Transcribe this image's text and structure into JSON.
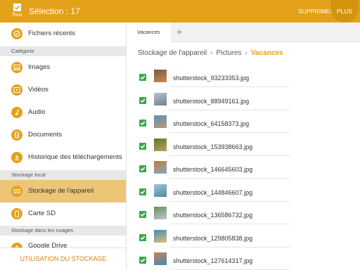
{
  "topbar": {
    "select_all_label": "Tous",
    "selection_title": "Sélection : 17",
    "delete_label": "SUPPRIMER",
    "more_label": "PLUS",
    "accent": "#e3a11a"
  },
  "sidebar": {
    "recent": "Fichiers récents",
    "category_header": "Catégorie",
    "categories": [
      "Images",
      "Vidéos",
      "Audio",
      "Documents",
      "Historique des téléchargements"
    ],
    "local_header": "Stockage local",
    "device": "Stockage de l'appareil",
    "sdcard": "Carte SD",
    "cloud_header": "Stockage dans les nuages",
    "gdrive": "Google Drive",
    "usage_button": "UTILISATION DU STOCKAGE"
  },
  "tabs": {
    "active": "Vacances",
    "add": "+"
  },
  "breadcrumb": [
    "Stockage de l'appareil",
    "Pictures",
    "Vacances"
  ],
  "files": [
    {
      "name": "shutterstock_93233353.jpg",
      "checked": true,
      "thumb": [
        "#7a5b3a",
        "#c98a5a"
      ]
    },
    {
      "name": "shutterstock_88949161.jpg",
      "checked": true,
      "thumb": [
        "#b7c6d1",
        "#6c7f8e"
      ]
    },
    {
      "name": "shutterstock_64158373.jpg",
      "checked": true,
      "thumb": [
        "#5f8fbf",
        "#b89a6a"
      ]
    },
    {
      "name": "shutterstock_153938663.jpg",
      "checked": true,
      "thumb": [
        "#5a7a2c",
        "#c0a060"
      ]
    },
    {
      "name": "shutterstock_146645603.jpg",
      "checked": true,
      "thumb": [
        "#c27b3a",
        "#8aa7c6"
      ]
    },
    {
      "name": "shutterstock_144846607.jpg",
      "checked": true,
      "thumb": [
        "#9cc7d6",
        "#4f8aa0"
      ]
    },
    {
      "name": "shutterstock_136586732.jpg",
      "checked": true,
      "thumb": [
        "#6f8c5a",
        "#b9c9d6"
      ]
    },
    {
      "name": "shutterstock_129805838.jpg",
      "checked": true,
      "thumb": [
        "#3f8dbf",
        "#e0c070"
      ]
    },
    {
      "name": "shutterstock_127614317.jpg",
      "checked": true,
      "thumb": [
        "#d07c5a",
        "#3b8fb8"
      ]
    }
  ]
}
